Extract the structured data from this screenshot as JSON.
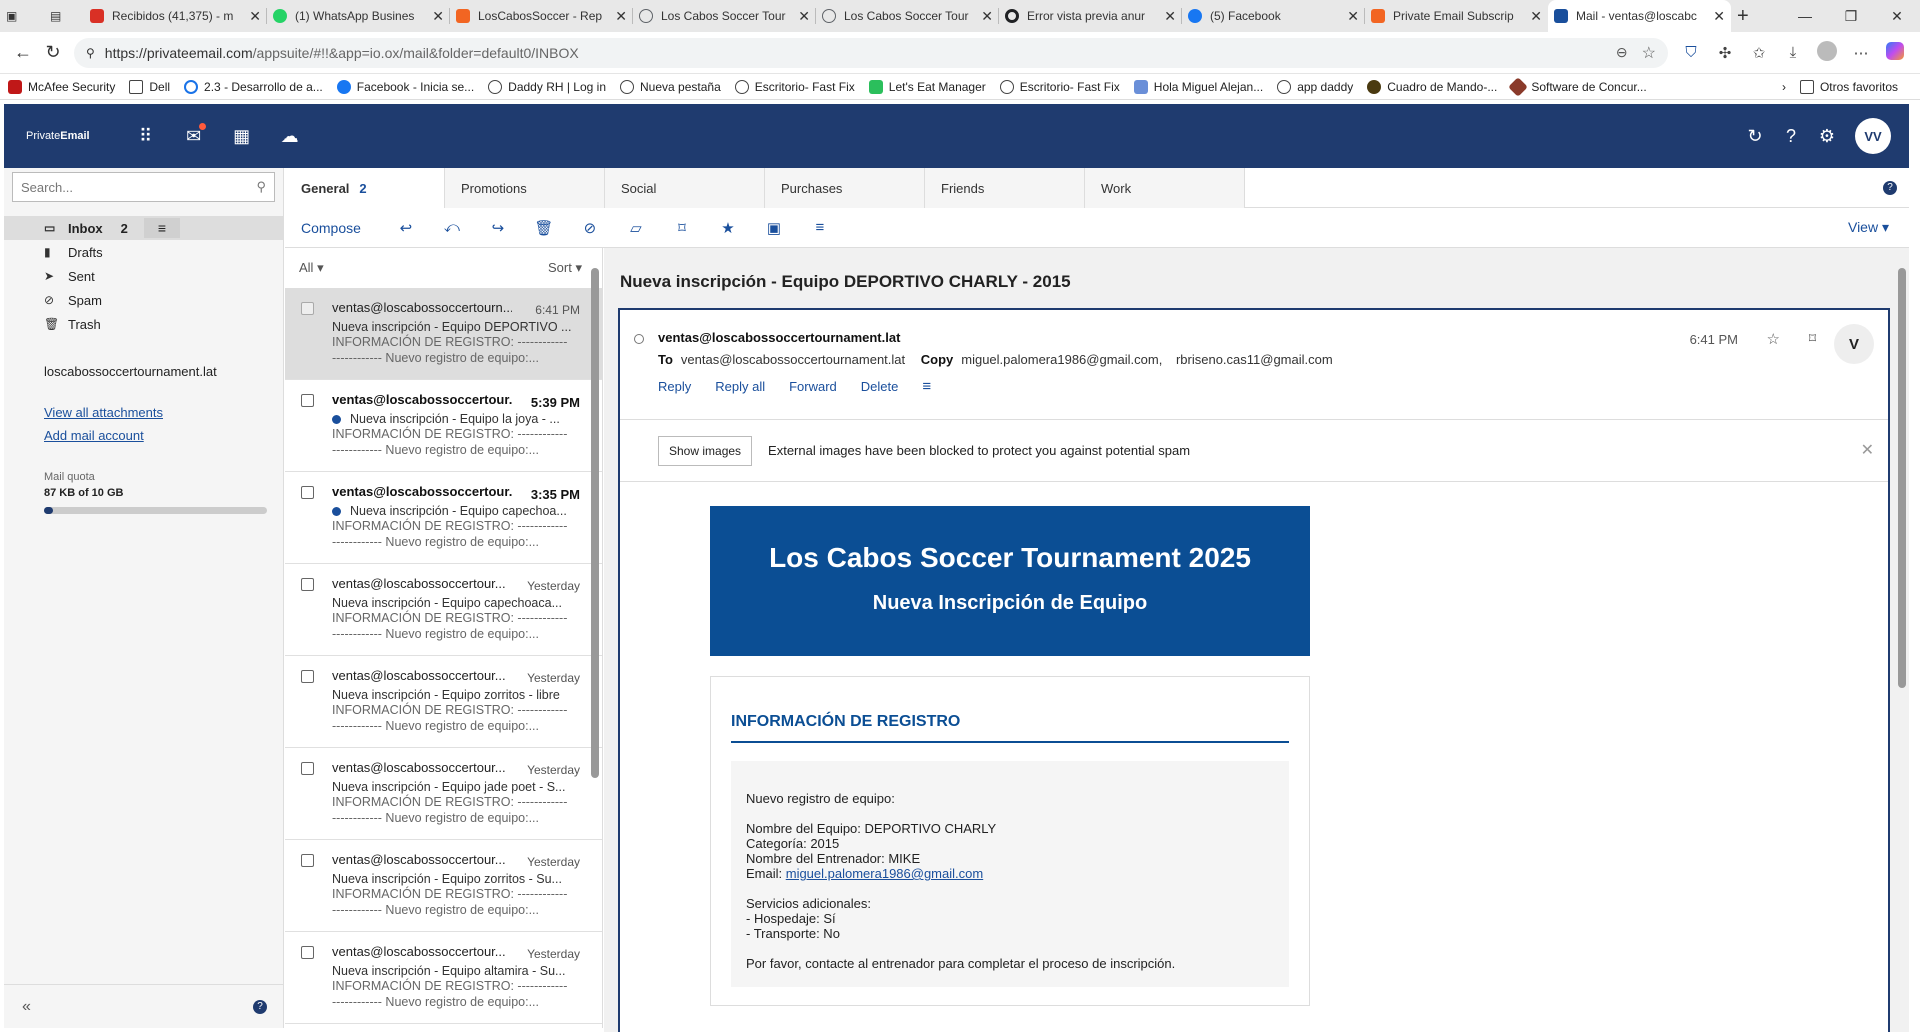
{
  "browser": {
    "tabs": [
      {
        "title": "Recibidos (41,375) - m",
        "color": "#d93025"
      },
      {
        "title": "(1) WhatsApp Busines",
        "color": "#25d366"
      },
      {
        "title": "LosCabosSoccer - Rep",
        "color": "#f26522"
      },
      {
        "title": "Los Cabos Soccer Tour",
        "color": "#5f6368"
      },
      {
        "title": "Los Cabos Soccer Tour",
        "color": "#5f6368"
      },
      {
        "title": "Error vista previa anur",
        "color": "#202124"
      },
      {
        "title": "(5) Facebook",
        "color": "#1877f2"
      },
      {
        "title": "Private Email Subscrip",
        "color": "#f26522"
      },
      {
        "title": "Mail - ventas@loscabc",
        "color": "#1a4f9c"
      }
    ],
    "url_main": "https://privateemail.com",
    "url_rest": "/appsuite/#!!&app=io.ox/mail&folder=default0/INBOX",
    "bookmarks": [
      "McAfee Security",
      "Dell",
      "2.3 - Desarrollo de a...",
      "Facebook - Inicia se...",
      "Daddy RH | Log in",
      "Nueva pestaña",
      "Escritorio- Fast Fix",
      "Let's Eat Manager",
      "Escritorio- Fast Fix",
      "Hola Miguel Alejan...",
      "app daddy",
      "Cuadro de Mando-...",
      "Software de Concur..."
    ],
    "other_bookmarks": "Otros favoritos"
  },
  "app": {
    "logo_light": "Private",
    "logo_bold": "Email",
    "avatar": "VV"
  },
  "sidebar": {
    "search_placeholder": "Search...",
    "folders": [
      {
        "label": "Inbox",
        "count": "2",
        "icon": "inbox-icon"
      },
      {
        "label": "Drafts",
        "icon": "drafts-icon"
      },
      {
        "label": "Sent",
        "icon": "sent-icon"
      },
      {
        "label": "Spam",
        "icon": "spam-icon"
      },
      {
        "label": "Trash",
        "icon": "trash-icon"
      }
    ],
    "account": "loscabossoccertournament.lat",
    "view_attachments": "View all attachments",
    "add_account": "Add mail account",
    "quota_label": "Mail quota",
    "quota_value": "87 KB of 10 GB",
    "quota_fraction": 0.04
  },
  "category_tabs": [
    {
      "label": "General",
      "count": "2"
    },
    {
      "label": "Promotions"
    },
    {
      "label": "Social"
    },
    {
      "label": "Purchases"
    },
    {
      "label": "Friends"
    },
    {
      "label": "Work"
    }
  ],
  "toolbar": {
    "compose": "Compose",
    "view": "View"
  },
  "list": {
    "filter": "All",
    "sort": "Sort",
    "messages": [
      {
        "from": "ventas@loscabossoccertourn...",
        "time": "6:41 PM",
        "subject": "Nueva inscripción - Equipo DEPORTIVO ...",
        "preview1": "INFORMACIÓN DE REGISTRO: ------------",
        "preview2": "------------ Nuevo registro de equipo:..."
      },
      {
        "from": "ventas@loscabossoccertour...",
        "time": "5:39 PM",
        "subject": "Nueva inscripción - Equipo la joya - ...",
        "preview1": "INFORMACIÓN DE REGISTRO: ------------",
        "preview2": "------------ Nuevo registro de equipo:..."
      },
      {
        "from": "ventas@loscabossoccertour...",
        "time": "3:35 PM",
        "subject": "Nueva inscripción - Equipo capechoa...",
        "preview1": "INFORMACIÓN DE REGISTRO: ------------",
        "preview2": "------------ Nuevo registro de equipo:..."
      },
      {
        "from": "ventas@loscabossoccertour...",
        "time": "Yesterday",
        "subject": "Nueva inscripción - Equipo capechoaca...",
        "preview1": "INFORMACIÓN DE REGISTRO: ------------",
        "preview2": "------------ Nuevo registro de equipo:..."
      },
      {
        "from": "ventas@loscabossoccertour...",
        "time": "Yesterday",
        "subject": "Nueva inscripción - Equipo zorritos - libre",
        "preview1": "INFORMACIÓN DE REGISTRO: ------------",
        "preview2": "------------ Nuevo registro de equipo:..."
      },
      {
        "from": "ventas@loscabossoccertour...",
        "time": "Yesterday",
        "subject": "Nueva inscripción - Equipo jade poet - S...",
        "preview1": "INFORMACIÓN DE REGISTRO: ------------",
        "preview2": "------------ Nuevo registro de equipo:..."
      },
      {
        "from": "ventas@loscabossoccertour...",
        "time": "Yesterday",
        "subject": "Nueva inscripción - Equipo zorritos - Su...",
        "preview1": "INFORMACIÓN DE REGISTRO: ------------",
        "preview2": "------------ Nuevo registro de equipo:..."
      },
      {
        "from": "ventas@loscabossoccertour...",
        "time": "Yesterday",
        "subject": "Nueva inscripción - Equipo altamira - Su...",
        "preview1": "INFORMACIÓN DE REGISTRO: ------------",
        "preview2": "------------ Nuevo registro de equipo:..."
      }
    ]
  },
  "detail": {
    "subject": "Nueva inscripción - Equipo DEPORTIVO CHARLY - 2015",
    "from": "ventas@loscabossoccertournament.lat",
    "to_label": "To",
    "to": "ventas@loscabossoccertournament.lat",
    "copy_label": "Copy",
    "copy1": "miguel.palomera1986@gmail.com,",
    "copy2": "rbriseno.cas11@gmail.com",
    "time": "6:41 PM",
    "avatar": "V",
    "actions": {
      "reply": "Reply",
      "reply_all": "Reply all",
      "forward": "Forward",
      "delete": "Delete"
    },
    "show_images": "Show images",
    "blocked_msg": "External images have been blocked to protect you against potential spam",
    "banner_title": "Los Cabos Soccer Tournament 2025",
    "banner_sub": "Nueva Inscripción de Equipo",
    "info_title": "INFORMACIÓN DE REGISTRO",
    "body": {
      "intro": "Nuevo registro de equipo:",
      "team": "Nombre del Equipo: DEPORTIVO CHARLY",
      "category": "Categoría: 2015",
      "coach": "Nombre del Entrenador: MIKE",
      "email_label": "Email: ",
      "email": "miguel.palomera1986@gmail.com",
      "services": "Servicios adicionales:",
      "lodging": "- Hospedaje: Sí",
      "transport": "- Transporte: No",
      "closing": "Por favor, contacte al entrenador para completar el proceso de inscripción."
    }
  }
}
